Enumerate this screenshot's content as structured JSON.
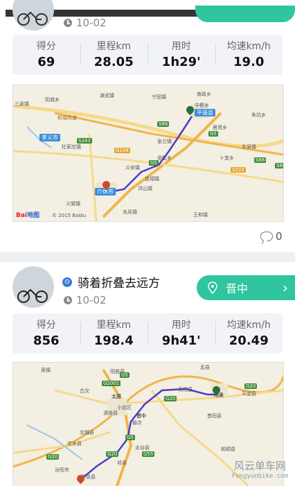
{
  "cards": [
    {
      "date": "10-02",
      "stats": [
        {
          "label": "得分",
          "value": "69"
        },
        {
          "label": "里程km",
          "value": "28.05"
        },
        {
          "label": "用时",
          "value": "1h29'"
        },
        {
          "label": "均速km/h",
          "value": "19.0"
        }
      ],
      "map": {
        "labels": [
          "演武镇",
          "宁固镇",
          "南政乡",
          "三泉镇",
          "阳城乡",
          "中都乡",
          "朱坑乡",
          "孝义市",
          "杜家庄镇",
          "东泉镇",
          "卜宜乡",
          "义安镇",
          "连福镇",
          "洪山镇",
          "介休市",
          "义棠镇",
          "龙凤镇",
          "王和镇",
          "平遥县",
          "和谐高速",
          "居贤乡",
          "张兰镇",
          "岳壁乡"
        ],
        "shields": [
          "S66",
          "G108",
          "G5",
          "S243",
          "G5",
          "S66",
          "S222",
          "S66"
        ],
        "brand_red": "Bai",
        "brand_blue": "地图",
        "copyright": "© 2015 Baidu"
      },
      "comments": "0"
    },
    {
      "username": "骑着折叠去远方",
      "region": "晋中",
      "date": "10-02",
      "stats": [
        {
          "label": "得分",
          "value": "856"
        },
        {
          "label": "里程km",
          "value": "198.4"
        },
        {
          "label": "用时",
          "value": "9h41'"
        },
        {
          "label": "均速km/h",
          "value": "20.49"
        }
      ],
      "map": {
        "labels": [
          "香镇",
          "阳曲县",
          "盂县",
          "平定县",
          "古交",
          "太原",
          "清徐县",
          "阳泉",
          "寿阳县",
          "晋中",
          "小店区",
          "榆次",
          "太谷县",
          "文水县",
          "汾阳市",
          "交城县",
          "祁县",
          "和顺县",
          "昔阳县",
          "平遥县"
        ],
        "shields": [
          "G5",
          "G2001",
          "G20",
          "G20",
          "G5",
          "G20",
          "G55",
          "G20"
        ]
      }
    }
  ],
  "watermark": {
    "cn": "风云单车网",
    "en": "Fengyunbike.com"
  },
  "colors": {
    "accent": "#2fc59e",
    "route": "#4b3cc9"
  }
}
